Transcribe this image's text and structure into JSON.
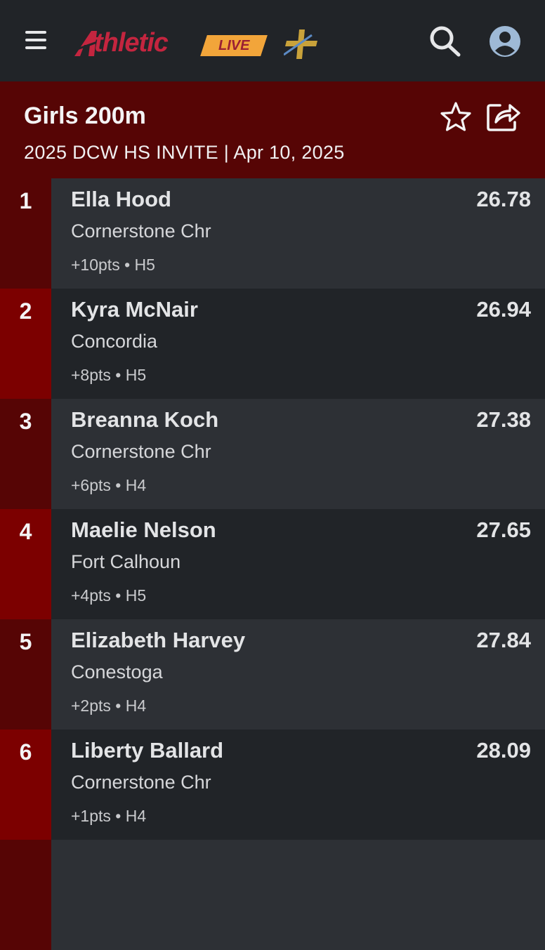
{
  "brand": {
    "logo_main": "thletic",
    "logo_live": "LIVE",
    "plus_icon": "plus-logo-icon",
    "colors": {
      "red": "#c4253f",
      "gold": "#f2a53a"
    }
  },
  "header": {
    "menu_icon": "hamburger-menu-icon",
    "search_icon": "search-icon",
    "account_icon": "account-icon"
  },
  "event": {
    "title": "Girls 200m",
    "subtitle": "2025 DCW HS INVITE | Apr 10, 2025",
    "star_icon": "star-icon",
    "share_icon": "share-icon",
    "color": "#560505"
  },
  "results": [
    {
      "place": "1",
      "name": "Ella Hood",
      "team": "Cornerstone Chr",
      "meta": "+10pts • H5",
      "mark": "26.78"
    },
    {
      "place": "2",
      "name": "Kyra McNair",
      "team": "Concordia",
      "meta": "+8pts • H5",
      "mark": "26.94"
    },
    {
      "place": "3",
      "name": "Breanna Koch",
      "team": "Cornerstone Chr",
      "meta": "+6pts • H4",
      "mark": "27.38"
    },
    {
      "place": "4",
      "name": "Maelie Nelson",
      "team": "Fort Calhoun",
      "meta": "+4pts • H5",
      "mark": "27.65"
    },
    {
      "place": "5",
      "name": "Elizabeth Harvey",
      "team": "Conestoga",
      "meta": "+2pts • H4",
      "mark": "27.84"
    },
    {
      "place": "6",
      "name": "Liberty Ballard",
      "team": "Cornerstone Chr",
      "meta": "+1pts • H4",
      "mark": "28.09"
    }
  ]
}
